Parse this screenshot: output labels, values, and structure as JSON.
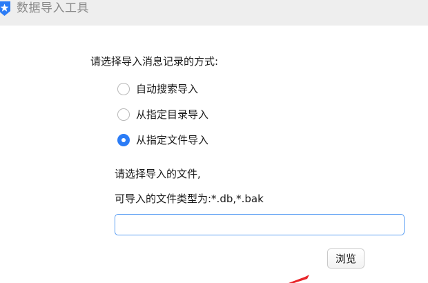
{
  "window": {
    "title": "数据导入工具",
    "icon": "app-logo-icon"
  },
  "form": {
    "prompt": "请选择导入消息记录的方式:",
    "options": [
      {
        "label": "自动搜索导入",
        "checked": false
      },
      {
        "label": "从指定目录导入",
        "checked": false
      },
      {
        "label": "从指定文件导入",
        "checked": true
      }
    ],
    "file_hint": "请选择导入的文件,",
    "file_types": "可导入的文件类型为:*.db,*.bak",
    "file_path": {
      "value": "",
      "placeholder": ""
    },
    "browse_label": "浏览"
  },
  "colors": {
    "accent": "#2b7cf6",
    "input_border": "#5b9ef3",
    "titlebar_bg": "#eeeeee",
    "annotation_red": "#e8262b"
  }
}
